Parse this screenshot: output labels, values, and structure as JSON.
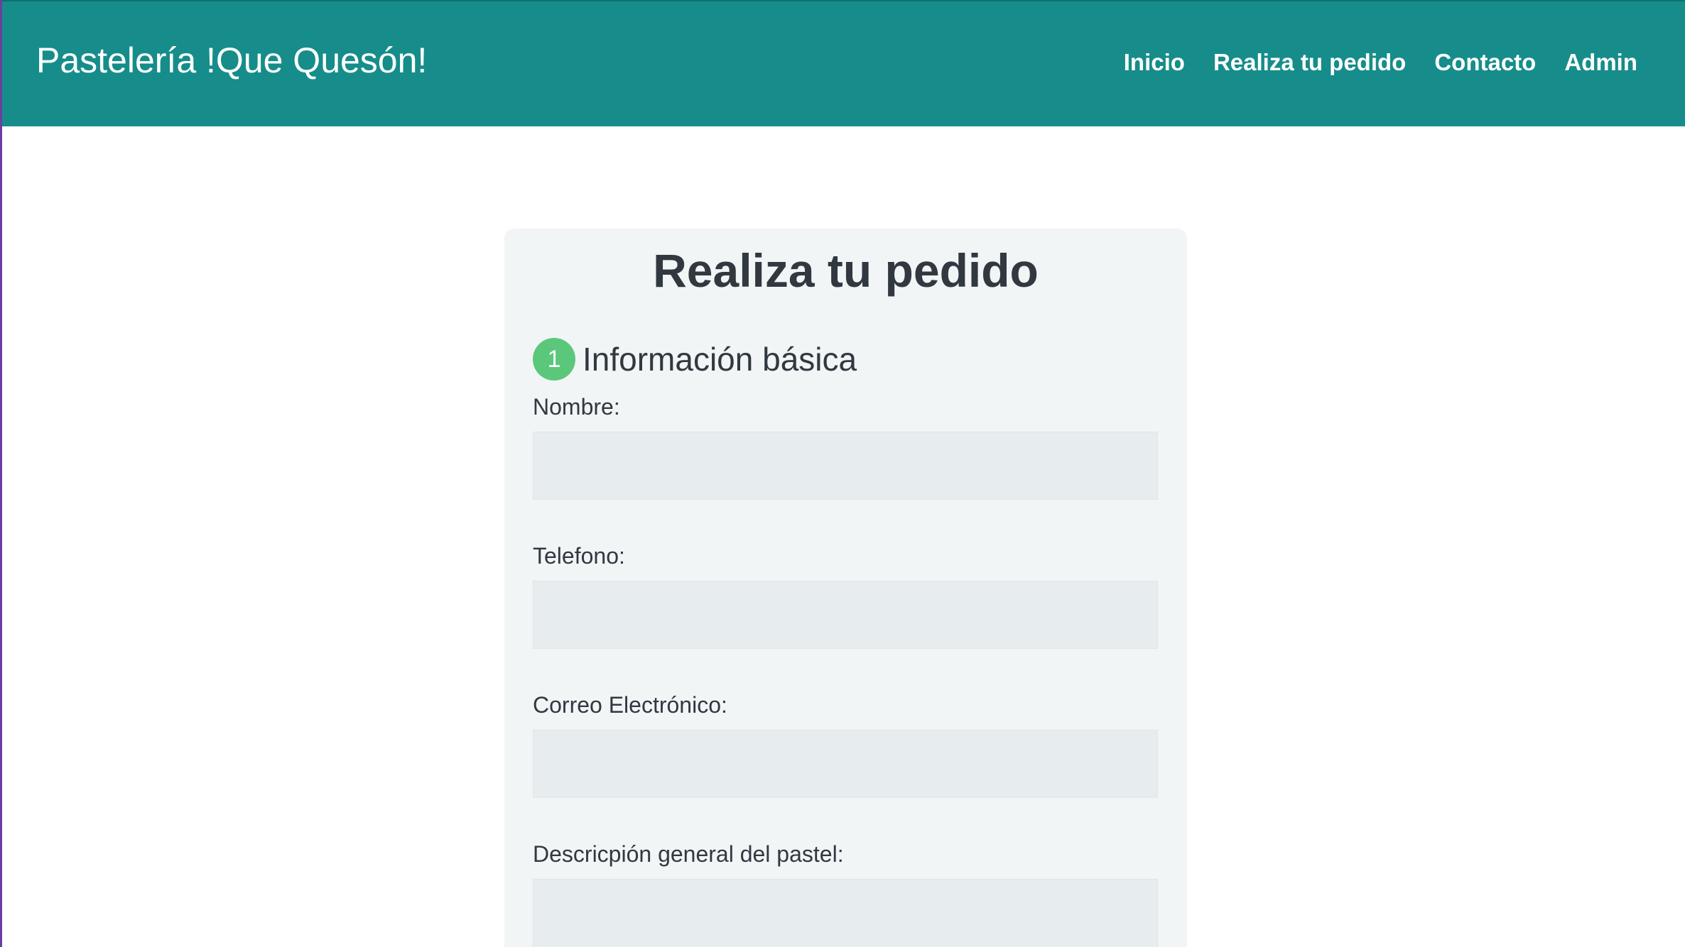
{
  "navbar": {
    "brand": "Pastelería !Que Quesón!",
    "links": [
      {
        "label": "Inicio"
      },
      {
        "label": "Realiza tu pedido"
      },
      {
        "label": "Contacto"
      },
      {
        "label": "Admin"
      }
    ]
  },
  "form": {
    "title": "Realiza tu pedido",
    "step": {
      "number": "1",
      "title": "Información básica"
    },
    "fields": [
      {
        "label": "Nombre:",
        "value": ""
      },
      {
        "label": "Telefono:",
        "value": ""
      },
      {
        "label": "Correo Electrónico:",
        "value": ""
      },
      {
        "label": "Descricpión general del pastel:",
        "value": ""
      }
    ]
  },
  "colors": {
    "navbar": "#168d8a",
    "card": "#f1f5f6",
    "input": "#e7ecee",
    "step_badge": "#5bc77a",
    "text": "#313840"
  }
}
